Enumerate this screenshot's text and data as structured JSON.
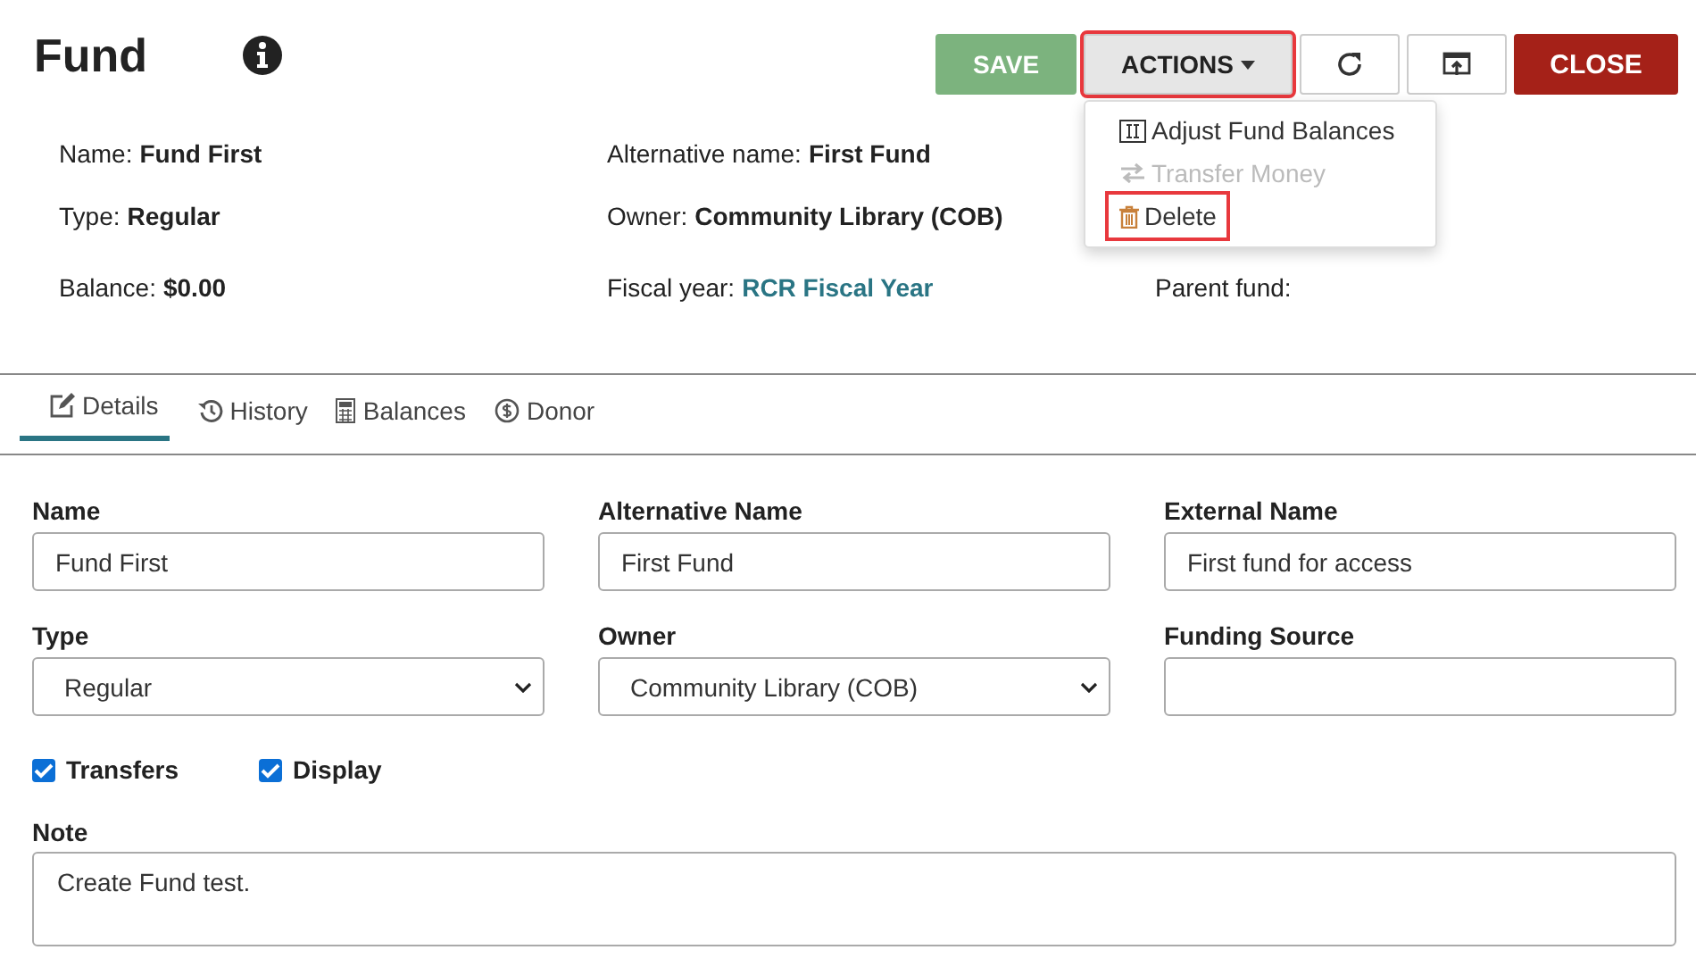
{
  "header": {
    "title": "Fund"
  },
  "toolbar": [
    {
      "kind": "save",
      "label": "SAVE",
      "highlighted": false
    },
    {
      "kind": "actions",
      "label": "ACTIONS",
      "highlighted": true,
      "expanded": true
    },
    {
      "kind": "refresh",
      "highlighted": false
    },
    {
      "kind": "export",
      "highlighted": false
    },
    {
      "kind": "close",
      "label": "CLOSE",
      "highlighted": false
    }
  ],
  "actions_menu": [
    {
      "kind": "adjust",
      "label": "Adjust Fund Balances",
      "disabled": false,
      "highlighted": false
    },
    {
      "kind": "transfer",
      "label": "Transfer Money",
      "disabled": true,
      "highlighted": false
    },
    {
      "kind": "trash",
      "label": "Delete",
      "disabled": false,
      "highlighted": true
    }
  ],
  "summary": [
    {
      "label": "Name:",
      "value": "Fund First"
    },
    {
      "label": "Alternative name:",
      "value": "First Fund"
    },
    {
      "label": "Type:",
      "value": "Regular"
    },
    {
      "label": "Owner:",
      "value": "Community Library (COB)"
    },
    {
      "label": "Balance:",
      "value": "$0.00"
    },
    {
      "label": "Fiscal year:",
      "value": "RCR Fiscal Year",
      "link": true
    },
    {
      "label": "Parent fund:"
    }
  ],
  "tabs": [
    {
      "kind": "edit",
      "label": "Details",
      "selected": true
    },
    {
      "kind": "history",
      "label": "History",
      "selected": false
    },
    {
      "kind": "calculator",
      "label": "Balances",
      "selected": false
    },
    {
      "kind": "dollar",
      "label": "Donor",
      "selected": false
    }
  ],
  "fields": [
    {
      "kind": "text",
      "label": "Name",
      "value": "Fund First"
    },
    {
      "kind": "text",
      "label": "Alternative Name",
      "value": "First Fund"
    },
    {
      "kind": "text",
      "label": "External Name",
      "value": "First fund for access"
    },
    {
      "kind": "select",
      "label": "Type",
      "value": "Regular"
    },
    {
      "kind": "select",
      "label": "Owner",
      "value": "Community Library (COB)"
    },
    {
      "kind": "text",
      "label": "Funding Source"
    }
  ],
  "checkboxes": [
    {
      "label": "Transfers",
      "checked": true
    },
    {
      "label": "Display",
      "checked": true
    }
  ],
  "note": {
    "label": "Note",
    "value": "Create Fund test."
  }
}
